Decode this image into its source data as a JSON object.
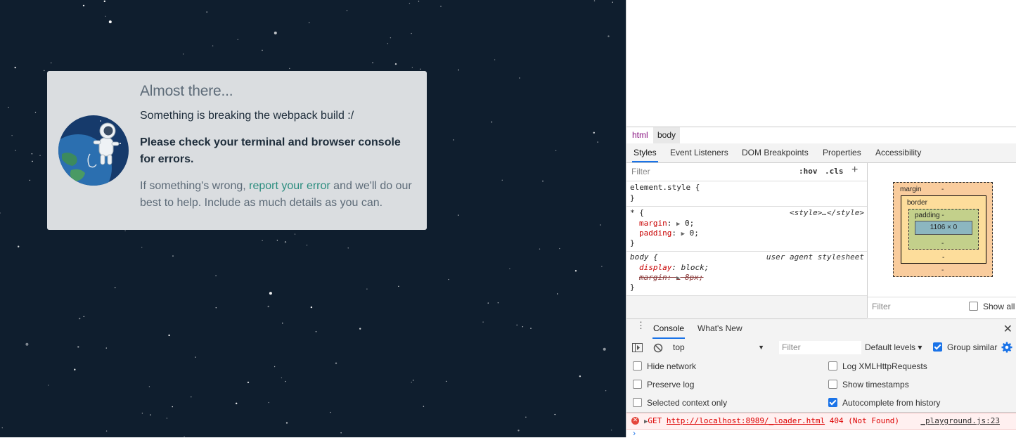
{
  "card": {
    "title": "Almost there...",
    "line1": "Something is breaking the webpack build :/",
    "line2": "Please check your terminal and browser console for errors.",
    "line3_before": "If something's wrong, ",
    "line3_link": "report your error",
    "line3_after": " and we'll do our best to help. Include as much details as you can."
  },
  "breadcrumbs": [
    "html",
    "body"
  ],
  "subtabs": [
    "Styles",
    "Event Listeners",
    "DOM Breakpoints",
    "Properties",
    "Accessibility"
  ],
  "styles": {
    "filter_placeholder": "Filter",
    "hov": ":hov",
    "cls": ".cls",
    "plus": "+",
    "rules": [
      {
        "selector": "element.style {",
        "close": "}"
      },
      {
        "selector": "* {",
        "source": "<style>…</style>",
        "props": [
          {
            "name": "margin",
            "value": "0;"
          },
          {
            "name": "padding",
            "value": "0;"
          }
        ],
        "close": "}"
      },
      {
        "selector": "body {",
        "source": "user agent stylesheet",
        "props": [
          {
            "name": "display",
            "value": "block;"
          },
          {
            "name": "margin",
            "value": "8px;",
            "overridden": true
          }
        ],
        "close": "}"
      }
    ]
  },
  "boxmodel": {
    "margin_label": "margin",
    "border_label": "border",
    "padding_label": "padding -",
    "content": "1106 × 0",
    "dash": "-",
    "filter_placeholder": "Filter",
    "show_all": "Show all"
  },
  "console": {
    "tabs": [
      "Console",
      "What's New"
    ],
    "context": "top",
    "filter_placeholder": "Filter",
    "levels": "Default levels ▾",
    "group_similar": "Group similar",
    "settings_left": [
      {
        "label": "Hide network",
        "checked": false
      },
      {
        "label": "Preserve log",
        "checked": false
      },
      {
        "label": "Selected context only",
        "checked": false
      }
    ],
    "settings_right": [
      {
        "label": "Log XMLHttpRequests",
        "checked": false
      },
      {
        "label": "Show timestamps",
        "checked": false
      },
      {
        "label": "Autocomplete from history",
        "checked": true
      }
    ],
    "error": {
      "method": "GET",
      "url": "http://localhost:8989/_loader.html",
      "status": "404 (Not Found)",
      "source": "_playground.js:23"
    },
    "prompt": "›"
  },
  "colors": {
    "space_bg": "#0f1e2e",
    "card_bg": "#dadde0",
    "link": "#2c8d7f",
    "accent": "#1a73e8",
    "error": "#d00000"
  }
}
